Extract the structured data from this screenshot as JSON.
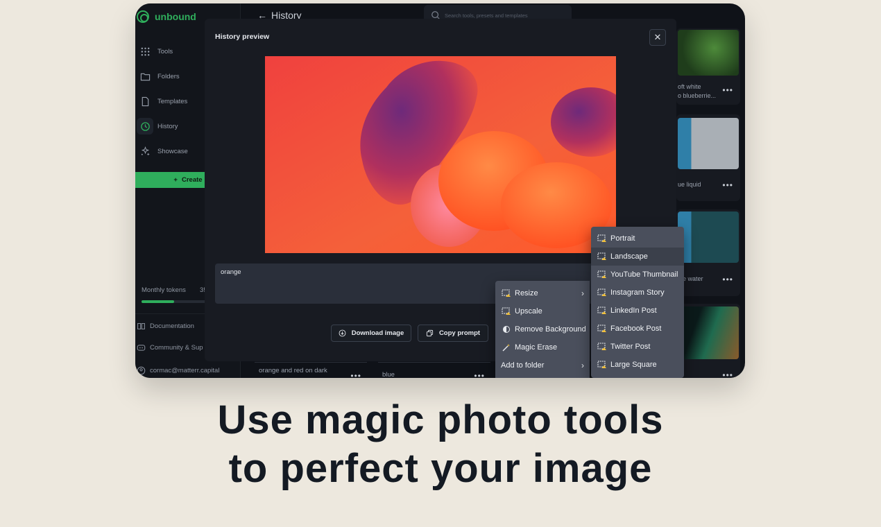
{
  "app": {
    "brand": "unbound",
    "page_title": "History",
    "search_placeholder": "Search tools, presets and templates"
  },
  "sidebar": {
    "items": [
      {
        "label": "Tools",
        "icon": "grid-icon"
      },
      {
        "label": "Folders",
        "icon": "folder-icon"
      },
      {
        "label": "Templates",
        "icon": "document-icon"
      },
      {
        "label": "History",
        "icon": "clock-icon",
        "active": true
      },
      {
        "label": "Showcase",
        "icon": "sparkle-icon"
      }
    ],
    "create_label": "Create",
    "tokens_label": "Monthly tokens",
    "tokens_count": "3!",
    "tokens_progress": 0.36,
    "footer": [
      {
        "label": "Documentation",
        "icon": "book-icon"
      },
      {
        "label": "Community & Sup",
        "icon": "discord-icon"
      },
      {
        "label": "cormac@matterr.capital",
        "icon": "user-icon"
      }
    ]
  },
  "history_cards": [
    {
      "label1": "oft white",
      "label2": "o blueberrie..."
    },
    {
      "label1": "ue liquid"
    },
    {
      "label1": "lue water"
    },
    {
      "label1": ""
    }
  ],
  "bottom_cards": [
    {
      "label": "orange and red on dark"
    },
    {
      "label": "blue"
    }
  ],
  "modal": {
    "title": "History preview",
    "prompt": "orange",
    "download_label": "Download image",
    "copy_label": "Copy prompt"
  },
  "context_menu": {
    "items": [
      {
        "label": "Resize",
        "has_submenu": true
      },
      {
        "label": "Upscale"
      },
      {
        "label": "Remove Background"
      },
      {
        "label": "Magic Erase"
      },
      {
        "label": "Add to folder",
        "has_submenu": true
      }
    ]
  },
  "resize_submenu": {
    "items": [
      {
        "label": "Portrait"
      },
      {
        "label": "Landscape",
        "hover": true
      },
      {
        "label": "YouTube Thumbnail"
      },
      {
        "label": "Instagram Story"
      },
      {
        "label": "LinkedIn Post"
      },
      {
        "label": "Facebook Post"
      },
      {
        "label": "Twitter Post"
      },
      {
        "label": "Large Square"
      }
    ]
  },
  "headline": {
    "line1": "Use magic photo tools",
    "line2": "to perfect your image"
  },
  "colors": {
    "accent": "#2fae5c",
    "background": "#ede8de",
    "app_bg": "#0f1218"
  }
}
